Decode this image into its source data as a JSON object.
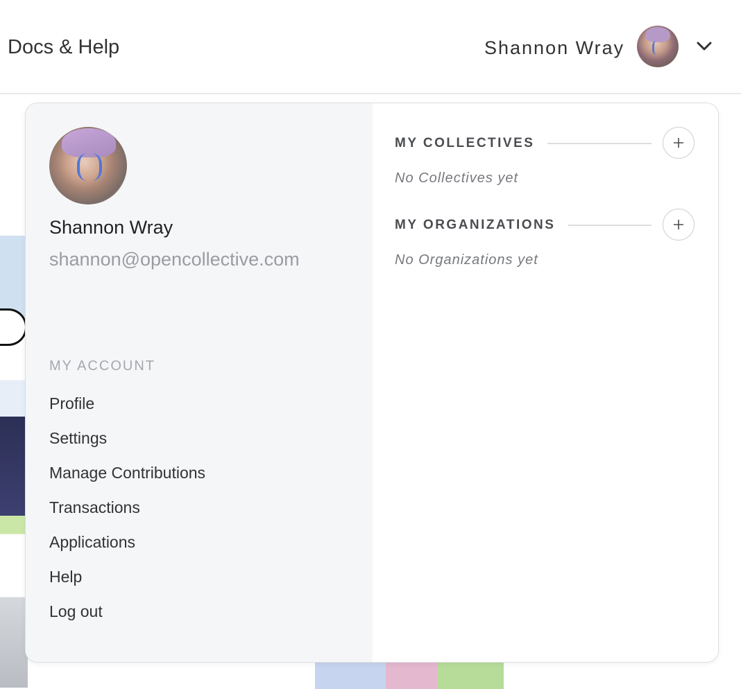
{
  "header": {
    "docs_link": "Docs & Help",
    "user_name": "Shannon Wray",
    "avatar_icon": "user-avatar",
    "menu_toggle_icon": "chevron-down-icon"
  },
  "profile": {
    "name": "Shannon Wray",
    "email": "shannon@opencollective.com"
  },
  "account": {
    "section_label": "MY ACCOUNT",
    "items": [
      {
        "label": "Profile"
      },
      {
        "label": "Settings"
      },
      {
        "label": "Manage Contributions"
      },
      {
        "label": "Transactions"
      },
      {
        "label": "Applications"
      },
      {
        "label": "Help"
      },
      {
        "label": "Log out"
      }
    ]
  },
  "collectives": {
    "title": "MY COLLECTIVES",
    "add_icon": "plus-icon",
    "empty": "No Collectives yet"
  },
  "organizations": {
    "title": "MY ORGANIZATIONS",
    "add_icon": "plus-icon",
    "empty": "No Organizations yet"
  }
}
